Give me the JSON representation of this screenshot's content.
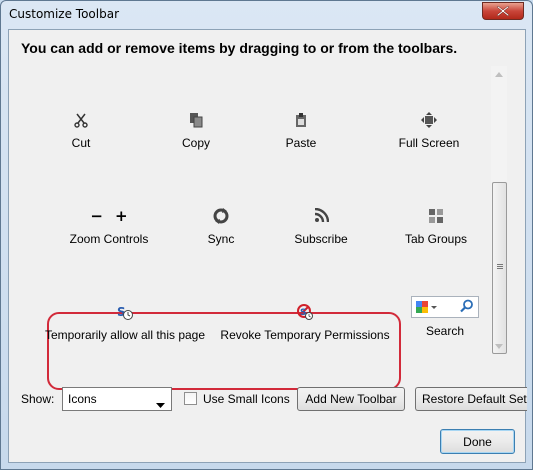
{
  "window": {
    "title": "Customize Toolbar",
    "close_icon": "close-icon"
  },
  "heading": "You can add or remove items by dragging to or from the toolbars.",
  "items": [
    {
      "label": "Cut",
      "icon": "scissors-icon"
    },
    {
      "label": "Copy",
      "icon": "copy-icon"
    },
    {
      "label": "Paste",
      "icon": "paste-icon"
    },
    {
      "label": "Full Screen",
      "icon": "fullscreen-icon"
    },
    {
      "label": "Zoom Controls",
      "icon": "zoom-icon"
    },
    {
      "label": "Sync",
      "icon": "sync-icon"
    },
    {
      "label": "Subscribe",
      "icon": "rss-icon"
    },
    {
      "label": "Tab Groups",
      "icon": "tab-groups-icon"
    },
    {
      "label": "Temporarily allow all this page",
      "icon": "noscript-allow-icon"
    },
    {
      "label": "Revoke Temporary Permissions",
      "icon": "noscript-revoke-icon"
    },
    {
      "label": "Search",
      "icon": "search-box-icon"
    }
  ],
  "zoom_symbols": {
    "minus": "−",
    "plus": "+"
  },
  "controls": {
    "show_label": "Show:",
    "show_value": "Icons",
    "small_icons_label": "Use Small Icons",
    "small_icons_checked": false,
    "add_toolbar": "Add New Toolbar",
    "restore_default": "Restore Default Set",
    "done": "Done"
  },
  "colors": {
    "highlight": "#d22a3a",
    "close": "#c9463a"
  }
}
